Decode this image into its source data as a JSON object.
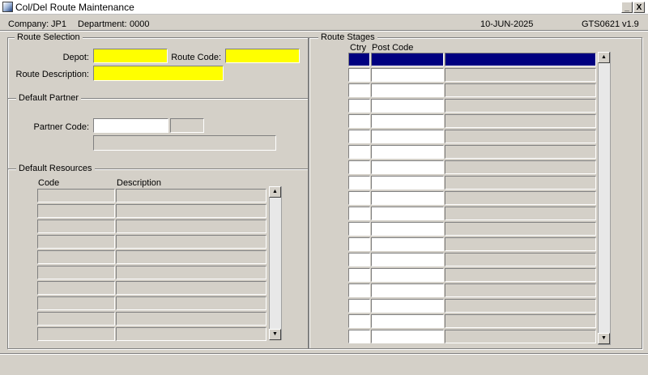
{
  "window": {
    "title": "Col/Del Route Maintenance",
    "minimize_glyph": "_",
    "close_glyph": "X",
    "icon": "oracle-forms-app-icon"
  },
  "info_bar": {
    "company_label": "Company:",
    "company_value": "JP1",
    "department_label": "Department:",
    "department_value": "0000",
    "date": "10-JUN-2025",
    "form_id": "GTS0621",
    "version": "v1.9"
  },
  "route_selection": {
    "title": "Route Selection",
    "depot_label": "Depot:",
    "depot_value": "",
    "route_code_label": "Route Code:",
    "route_code_value": "",
    "route_description_label": "Route Description:",
    "route_description_value": "",
    "required_color": "#ffff00"
  },
  "default_partner": {
    "title": "Default Partner",
    "partner_code_label": "Partner Code:",
    "partner_code_value": "",
    "partner_suffix_value": "",
    "partner_name_value": ""
  },
  "default_resources": {
    "title": "Default Resources",
    "columns": {
      "code": "Code",
      "description": "Description"
    },
    "rows": [
      {
        "code": "",
        "description": ""
      },
      {
        "code": "",
        "description": ""
      },
      {
        "code": "",
        "description": ""
      },
      {
        "code": "",
        "description": ""
      },
      {
        "code": "",
        "description": ""
      },
      {
        "code": "",
        "description": ""
      },
      {
        "code": "",
        "description": ""
      },
      {
        "code": "",
        "description": ""
      },
      {
        "code": "",
        "description": ""
      },
      {
        "code": "",
        "description": ""
      }
    ]
  },
  "route_stages": {
    "title": "Route Stages",
    "columns": {
      "ctry": "Ctry",
      "post_code": "Post Code",
      "description": ""
    },
    "selected_color": "#000080",
    "rows": [
      {
        "ctry": "",
        "post_code": "",
        "description": ""
      },
      {
        "ctry": "",
        "post_code": "",
        "description": ""
      },
      {
        "ctry": "",
        "post_code": "",
        "description": ""
      },
      {
        "ctry": "",
        "post_code": "",
        "description": ""
      },
      {
        "ctry": "",
        "post_code": "",
        "description": ""
      },
      {
        "ctry": "",
        "post_code": "",
        "description": ""
      },
      {
        "ctry": "",
        "post_code": "",
        "description": ""
      },
      {
        "ctry": "",
        "post_code": "",
        "description": ""
      },
      {
        "ctry": "",
        "post_code": "",
        "description": ""
      },
      {
        "ctry": "",
        "post_code": "",
        "description": ""
      },
      {
        "ctry": "",
        "post_code": "",
        "description": ""
      },
      {
        "ctry": "",
        "post_code": "",
        "description": ""
      },
      {
        "ctry": "",
        "post_code": "",
        "description": ""
      },
      {
        "ctry": "",
        "post_code": "",
        "description": ""
      },
      {
        "ctry": "",
        "post_code": "",
        "description": ""
      },
      {
        "ctry": "",
        "post_code": "",
        "description": ""
      },
      {
        "ctry": "",
        "post_code": "",
        "description": ""
      },
      {
        "ctry": "",
        "post_code": "",
        "description": ""
      },
      {
        "ctry": "",
        "post_code": "",
        "description": ""
      }
    ]
  },
  "scroll": {
    "up_glyph": "▲",
    "down_glyph": "▼"
  }
}
